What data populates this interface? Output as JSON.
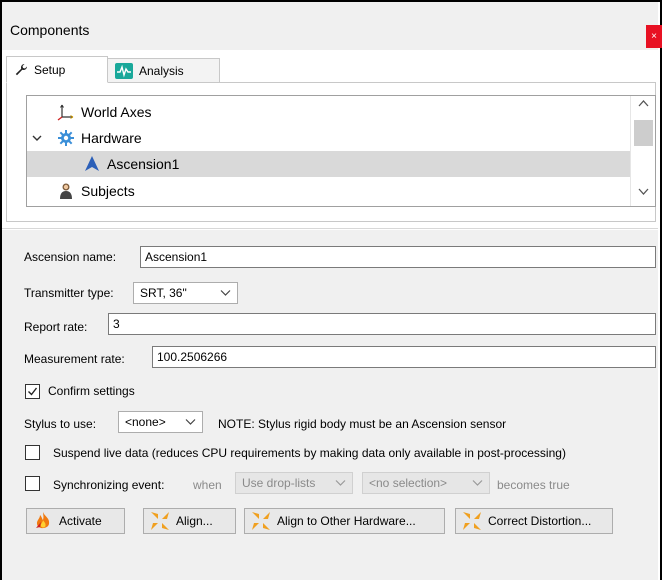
{
  "window": {
    "title": "Components",
    "close_glyph": "×"
  },
  "tabs": [
    {
      "label": "Setup",
      "icon": "wrench-icon",
      "active": true
    },
    {
      "label": "Analysis",
      "icon": "waveform-icon",
      "active": false
    }
  ],
  "tree": {
    "items": [
      {
        "label": "World Axes",
        "icon": "axes-icon"
      },
      {
        "label": "Hardware",
        "icon": "gear-icon",
        "expanded": true
      },
      {
        "label": "Ascension1",
        "icon": "arrow-icon",
        "selected": true
      },
      {
        "label": "Subjects",
        "icon": "person-icon"
      }
    ]
  },
  "form": {
    "ascension_name_label": "Ascension name:",
    "ascension_name_value": "Ascension1",
    "transmitter_type_label": "Transmitter type:",
    "transmitter_type_value": "SRT, 36\"",
    "report_rate_label": "Report rate:",
    "report_rate_value": "3",
    "measurement_rate_label": "Measurement rate:",
    "measurement_rate_value": "100.2506266",
    "confirm_settings_label": "Confirm settings",
    "confirm_settings_checked": true,
    "stylus_label": "Stylus to use:",
    "stylus_value": "<none>",
    "stylus_note": "NOTE:  Stylus rigid body must be an Ascension sensor",
    "suspend_label": "Suspend live data (reduces CPU requirements by making data only available in post-processing)",
    "suspend_checked": false,
    "sync_label": "Synchronizing event:",
    "sync_checked": false,
    "sync_when": "when",
    "sync_droplist": "Use drop-lists",
    "sync_selection": "<no selection>",
    "sync_becomes": "becomes true"
  },
  "buttons": {
    "activate": "Activate",
    "align": "Align...",
    "align_other": "Align to Other Hardware...",
    "correct": "Correct Distortion..."
  },
  "colors": {
    "close": "#e81123",
    "panel_bg": "#f0f0f0",
    "selection": "#d9d9d9"
  }
}
